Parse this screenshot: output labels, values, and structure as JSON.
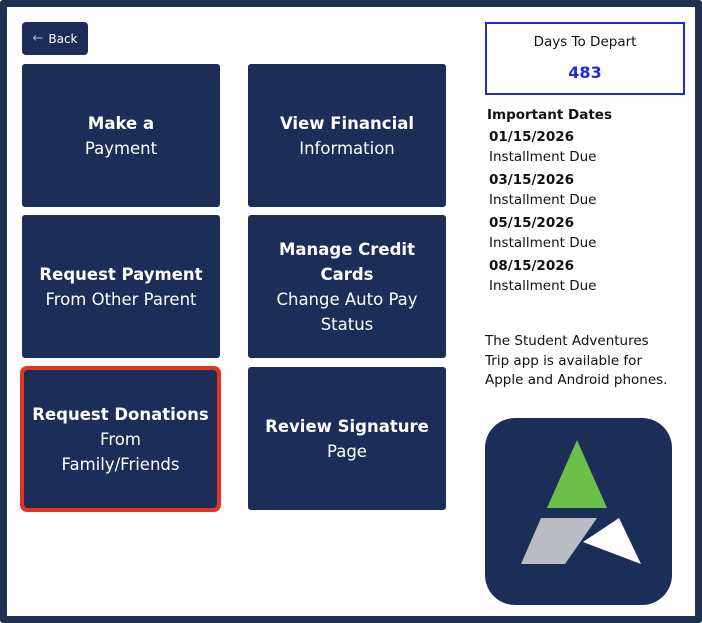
{
  "header": {
    "back_label": "Back"
  },
  "tiles": [
    {
      "bold": "Make a",
      "regular": "Payment"
    },
    {
      "bold": "View Financial",
      "regular": "Information"
    },
    {
      "bold": "Request Payment",
      "regular": "From Other Parent"
    },
    {
      "bold": "Manage Credit Cards",
      "regular": "Change Auto Pay Status"
    },
    {
      "bold": "Request Donations",
      "regular": "From Family/Friends"
    },
    {
      "bold": "Review Signature",
      "regular": "Page"
    }
  ],
  "sidebar": {
    "days_label": "Days To Depart",
    "days_value": "483",
    "dates_heading": "Important Dates",
    "dates": [
      {
        "date": "01/15/2026",
        "label": "Installment Due"
      },
      {
        "date": "03/15/2026",
        "label": "Installment Due"
      },
      {
        "date": "05/15/2026",
        "label": "Installment Due"
      },
      {
        "date": "08/15/2026",
        "label": "Installment Due"
      }
    ],
    "app_note": "The Student Adventures Trip app is available for Apple and Android phones."
  },
  "colors": {
    "tile_bg": "#1c2d58",
    "selected_outline": "#e5341f",
    "days_accent": "#1f2bd6",
    "logo_green": "#6cc04a",
    "logo_gray": "#b9bcc0",
    "logo_white": "#ffffff"
  }
}
